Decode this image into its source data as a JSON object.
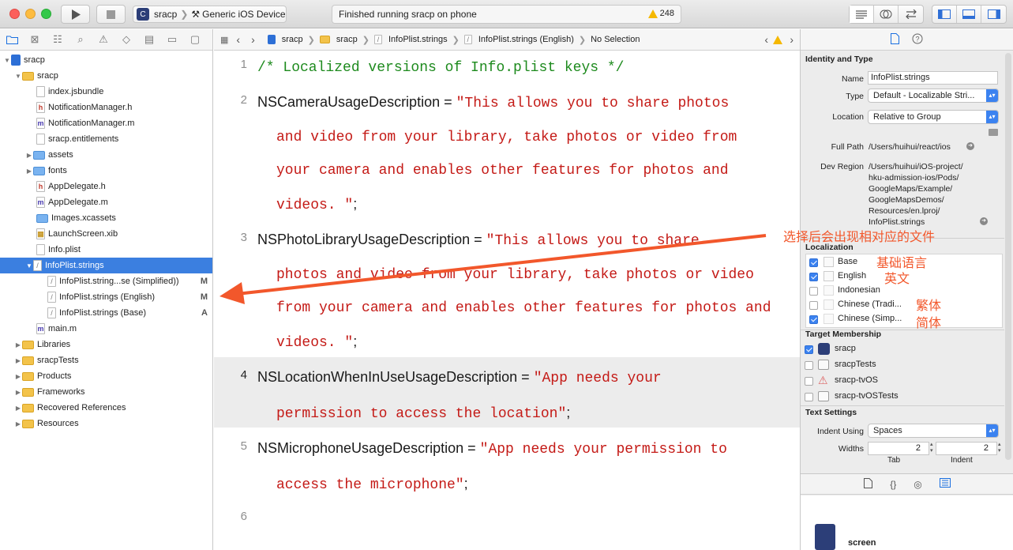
{
  "toolbar": {
    "scheme_target": "sracp",
    "scheme_device": "Generic iOS Device",
    "status_text": "Finished running sracp on phone",
    "warning_count": "248"
  },
  "navigator": {
    "items": [
      {
        "label": "sracp",
        "badge": ""
      },
      {
        "label": "sracp",
        "badge": ""
      },
      {
        "label": "index.jsbundle",
        "badge": ""
      },
      {
        "label": "NotificationManager.h",
        "badge": ""
      },
      {
        "label": "NotificationManager.m",
        "badge": ""
      },
      {
        "label": "sracp.entitlements",
        "badge": ""
      },
      {
        "label": "assets",
        "badge": ""
      },
      {
        "label": "fonts",
        "badge": ""
      },
      {
        "label": "AppDelegate.h",
        "badge": ""
      },
      {
        "label": "AppDelegate.m",
        "badge": ""
      },
      {
        "label": "Images.xcassets",
        "badge": ""
      },
      {
        "label": "LaunchScreen.xib",
        "badge": ""
      },
      {
        "label": "Info.plist",
        "badge": ""
      },
      {
        "label": "InfoPlist.strings",
        "badge": ""
      },
      {
        "label": "InfoPlist.string...se (Simplified))",
        "badge": "M"
      },
      {
        "label": "InfoPlist.strings (English)",
        "badge": "M"
      },
      {
        "label": "InfoPlist.strings (Base)",
        "badge": "A"
      },
      {
        "label": "main.m",
        "badge": ""
      },
      {
        "label": "Libraries",
        "badge": ""
      },
      {
        "label": "sracpTests",
        "badge": ""
      },
      {
        "label": "Products",
        "badge": ""
      },
      {
        "label": "Frameworks",
        "badge": ""
      },
      {
        "label": "Recovered References",
        "badge": ""
      },
      {
        "label": "Resources",
        "badge": ""
      }
    ]
  },
  "jumpbar": {
    "crumbs": [
      "sracp",
      "sracp",
      "InfoPlist.strings",
      "InfoPlist.strings (English)",
      "No Selection"
    ]
  },
  "editor": {
    "line_numbers": [
      "1",
      "2",
      "3",
      "4",
      "5",
      "6"
    ],
    "line1": "/* Localized versions of Info.plist keys */",
    "line2_key": "NSCameraUsageDescription",
    "line2_a": "\"This allows you to share photos",
    "line2_b": "and video from your library, take photos or video from",
    "line2_c": "your camera and enables other features for photos and",
    "line2_d": "videos. \"",
    "line3_key": "NSPhotoLibraryUsageDescription",
    "line3_a": "\"This allows you to share",
    "line3_b": "photos and video from your library, take photos or video",
    "line3_c": "from your camera and enables other features for photos and",
    "line3_d": "videos. \"",
    "line4_key": "NSLocationWhenInUseUsageDescription",
    "line4_a": "\"App needs your",
    "line4_b": "permission to access the location\"",
    "line5_key": "NSMicrophoneUsageDescription",
    "line5_a": "\"App needs your permission to",
    "line5_b": "access the microphone\"",
    "eq": " = ",
    "semi": ";"
  },
  "inspector": {
    "identity_title": "Identity and Type",
    "name_label": "Name",
    "name_value": "InfoPlist.strings",
    "type_label": "Type",
    "type_value": "Default - Localizable Stri...",
    "location_label": "Location",
    "location_value": "Relative to Group",
    "fullpath_label": "Full Path",
    "fullpath_value": "/Users/huihui/react/ios",
    "devregion_label": "Dev Region",
    "devregion_lines": [
      "/Users/huihui/iOS-project/",
      "hku-admission-ios/Pods/",
      "GoogleMaps/Example/",
      "GoogleMapsDemos/",
      "Resources/en.lproj/",
      "InfoPlist.strings"
    ],
    "localization_title": "Localization",
    "localizations": [
      {
        "label": "Base",
        "checked": true
      },
      {
        "label": "English",
        "checked": true
      },
      {
        "label": "Indonesian",
        "checked": false
      },
      {
        "label": "Chinese (Tradi...",
        "checked": false
      },
      {
        "label": "Chinese (Simp...",
        "checked": true
      }
    ],
    "target_title": "Target Membership",
    "targets": [
      {
        "label": "sracp",
        "checked": true
      },
      {
        "label": "sracpTests",
        "checked": false
      },
      {
        "label": "sracp-tvOS",
        "checked": false
      },
      {
        "label": "sracp-tvOSTests",
        "checked": false
      }
    ],
    "text_settings_title": "Text Settings",
    "indent_using_label": "Indent Using",
    "indent_using_value": "Spaces",
    "widths_label": "Widths",
    "tab_value": "2",
    "indent_value": "2",
    "tab_caption": "Tab",
    "indent_caption": "Indent",
    "library_item_label": "screen"
  },
  "annotations": {
    "main_note": "选择后会出现相对应的文件",
    "base_note": "基础语言",
    "english_note": "英文",
    "traditional_note": "繁体",
    "simplified_note": "简体",
    "color": "#f2572b"
  }
}
